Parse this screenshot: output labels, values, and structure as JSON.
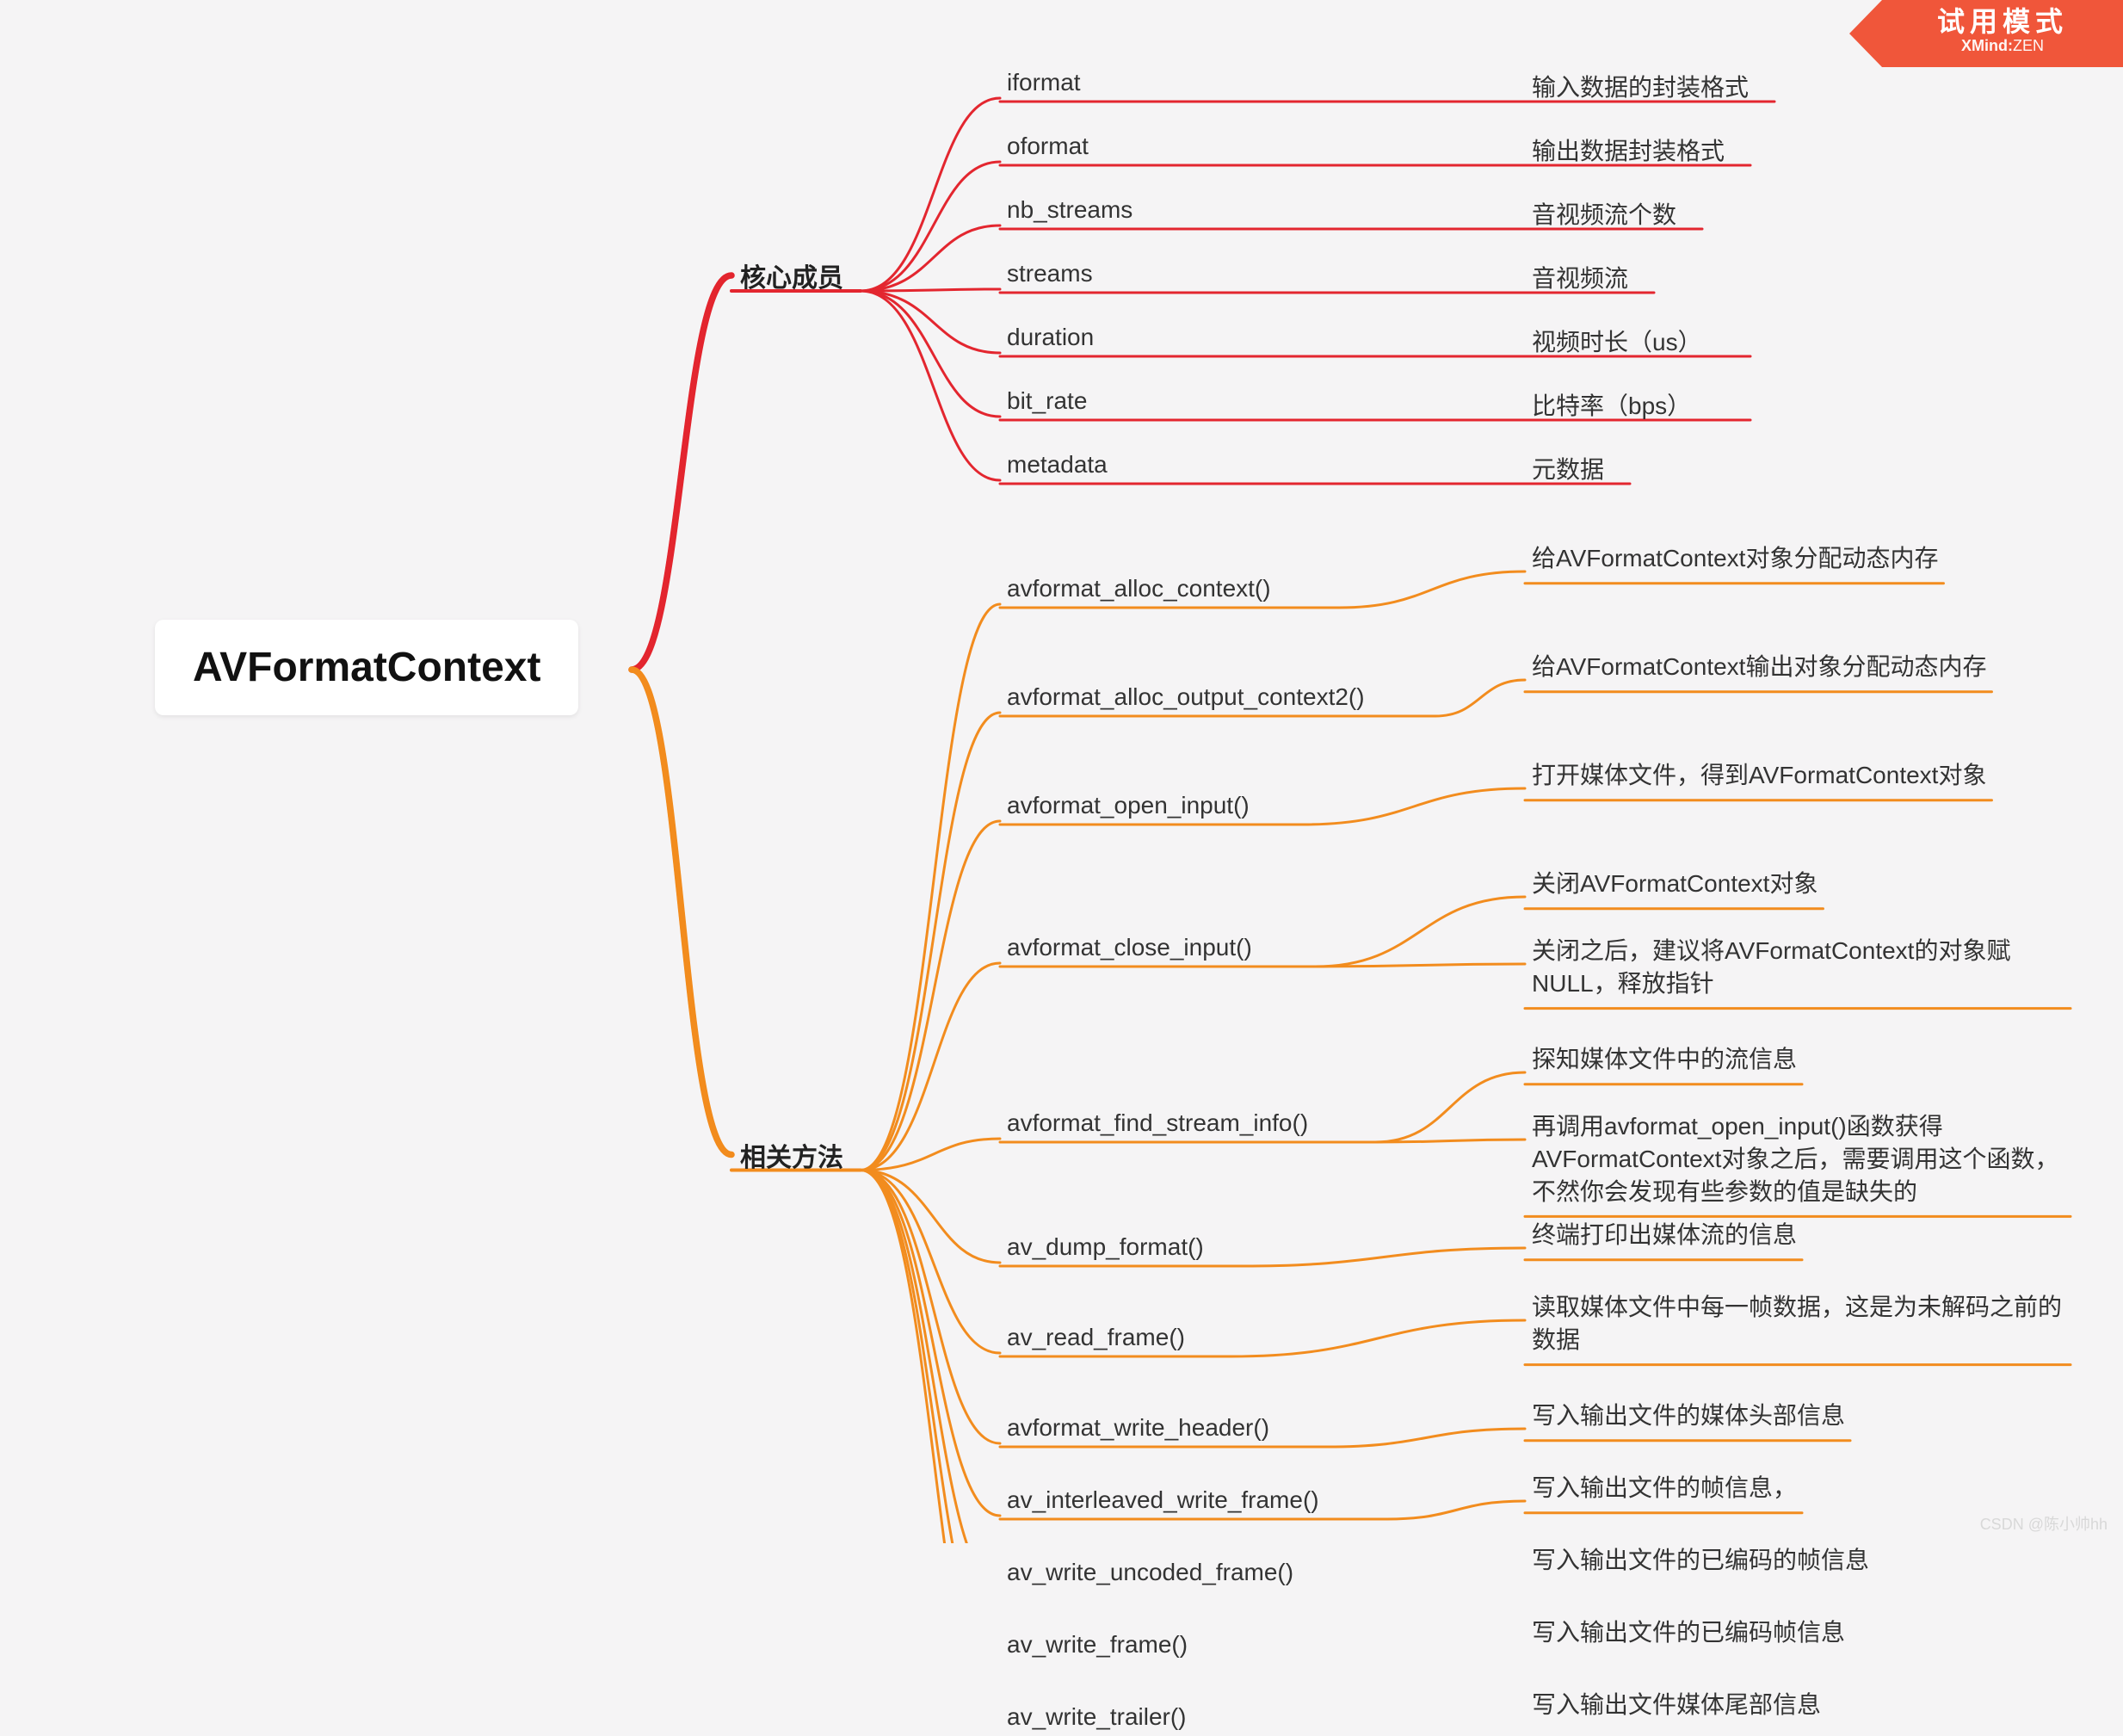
{
  "root": {
    "title": "AVFormatContext"
  },
  "groups": [
    {
      "id": "core",
      "label": "核心成员",
      "color": "#e3262f",
      "children": [
        {
          "name": "iformat",
          "desc": [
            "输入数据的封装格式"
          ]
        },
        {
          "name": "oformat",
          "desc": [
            "输出数据封装格式"
          ]
        },
        {
          "name": "nb_streams",
          "desc": [
            "音视频流个数"
          ]
        },
        {
          "name": "streams",
          "desc": [
            "音视频流"
          ]
        },
        {
          "name": "duration",
          "desc": [
            "视频时长（us）"
          ]
        },
        {
          "name": "bit_rate",
          "desc": [
            "比特率（bps）"
          ]
        },
        {
          "name": "metadata",
          "desc": [
            "元数据"
          ]
        }
      ]
    },
    {
      "id": "methods",
      "label": "相关方法",
      "color": "#f28c1e",
      "children": [
        {
          "name": "avformat_alloc_context()",
          "desc": [
            "给AVFormatContext对象分配动态内存"
          ]
        },
        {
          "name": "avformat_alloc_output_context2()",
          "desc": [
            "给AVFormatContext输出对象分配动态内存"
          ]
        },
        {
          "name": "avformat_open_input()",
          "desc": [
            "打开媒体文件，得到AVFormatContext对象"
          ]
        },
        {
          "name": "avformat_close_input()",
          "desc": [
            "关闭AVFormatContext对象",
            "关闭之后，建议将AVFormatContext的对象赋NULL，释放指针"
          ]
        },
        {
          "name": "avformat_find_stream_info()",
          "desc": [
            "探知媒体文件中的流信息",
            "再调用avformat_open_input()函数获得AVFormatContext对象之后，需要调用这个函数，不然你会发现有些参数的值是缺失的"
          ]
        },
        {
          "name": "av_dump_format()",
          "desc": [
            "终端打印出媒体流的信息"
          ]
        },
        {
          "name": "av_read_frame()",
          "desc": [
            "读取媒体文件中每一帧数据，这是为未解码之前的数据"
          ]
        },
        {
          "name": "avformat_write_header()",
          "desc": [
            "写入输出文件的媒体头部信息"
          ]
        },
        {
          "name": "av_interleaved_write_frame()",
          "desc": [
            "写入输出文件的帧信息，"
          ]
        },
        {
          "name": "av_write_uncoded_frame()",
          "desc": [
            "写入输出文件的已编码的帧信息"
          ]
        },
        {
          "name": "av_write_frame()",
          "desc": [
            "写入输出文件的已编码帧信息"
          ]
        },
        {
          "name": "av_write_trailer()",
          "desc": [
            "写入输出文件媒体尾部信息"
          ]
        }
      ]
    }
  ],
  "badge": {
    "line1": "试用模式",
    "line2a": "XMind:",
    "line2b": "ZEN"
  },
  "watermark": "CSDN @陈小帅hh"
}
